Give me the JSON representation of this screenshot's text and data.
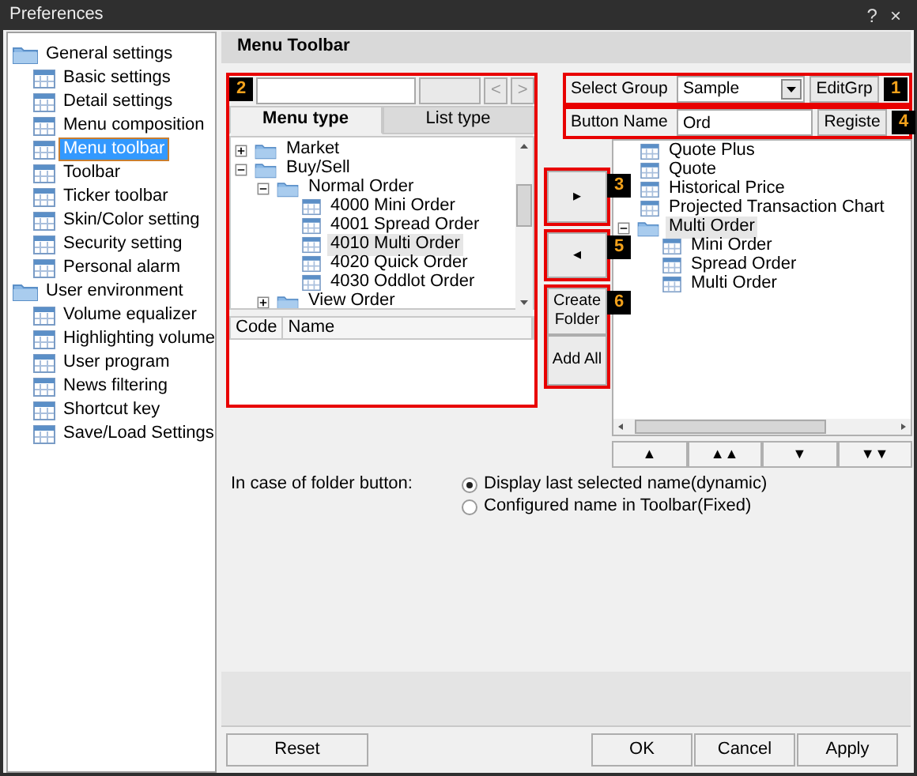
{
  "window": {
    "title": "Preferences",
    "controls": [
      "?",
      "×"
    ]
  },
  "sidebar": {
    "groups": [
      {
        "label": "General settings",
        "items": [
          {
            "label": "Basic settings",
            "selected": false
          },
          {
            "label": "Detail settings",
            "selected": false
          },
          {
            "label": "Menu composition",
            "selected": false
          },
          {
            "label": "Menu toolbar",
            "selected": true
          },
          {
            "label": "Toolbar",
            "selected": false
          },
          {
            "label": "Ticker toolbar",
            "selected": false
          },
          {
            "label": "Skin/Color setting",
            "selected": false
          },
          {
            "label": "Security setting",
            "selected": false
          },
          {
            "label": "Personal alarm",
            "selected": false
          }
        ]
      },
      {
        "label": "User environment",
        "items": [
          {
            "label": "Volume equalizer",
            "selected": false
          },
          {
            "label": "Highlighting volume",
            "selected": false
          },
          {
            "label": "User program",
            "selected": false
          },
          {
            "label": "News filtering",
            "selected": false
          },
          {
            "label": "Shortcut key",
            "selected": false
          },
          {
            "label": "Save/Load Settings",
            "selected": false
          }
        ]
      }
    ]
  },
  "page_title": "Menu Toolbar",
  "menu_panel": {
    "badge": "2",
    "nav_buttons": [
      "<",
      ">"
    ],
    "tabs": [
      {
        "label": "Menu type",
        "selected": true
      },
      {
        "label": "List type",
        "selected": false
      }
    ],
    "tree": [
      {
        "kind": "folder",
        "label": "Market",
        "expanded": false,
        "selected": false
      },
      {
        "kind": "folder",
        "label": "Buy/Sell",
        "expanded": true,
        "selected": false,
        "children": [
          {
            "kind": "folder",
            "label": "Normal Order",
            "expanded": true,
            "selected": false,
            "children": [
              {
                "kind": "item",
                "label": "4000 Mini Order",
                "selected": false
              },
              {
                "kind": "item",
                "label": "4001 Spread Order",
                "selected": false
              },
              {
                "kind": "item",
                "label": "4010 Multi Order",
                "selected": true
              },
              {
                "kind": "item",
                "label": "4020 Quick Order",
                "selected": false
              },
              {
                "kind": "item",
                "label": "4030 Oddlot Order",
                "selected": false
              }
            ]
          },
          {
            "kind": "folder",
            "label": "View Order",
            "expanded": false,
            "selected": false
          }
        ]
      }
    ],
    "list_columns": [
      "Code",
      "Name"
    ]
  },
  "group_selector": {
    "badge": "1",
    "label": "Select Group",
    "value": "Sample",
    "button": "EditGrp"
  },
  "button_name": {
    "badge": "4",
    "label": "Button Name",
    "value": "Ord",
    "button": "Registe"
  },
  "transfer_buttons": [
    {
      "badge": "3",
      "labels": [
        "▸"
      ]
    },
    {
      "badge": "5",
      "labels": [
        "◂"
      ]
    },
    {
      "badge": "6",
      "labels": [
        "Create Folder",
        "Add All"
      ]
    }
  ],
  "toolbar_tree": [
    {
      "kind": "item",
      "label": "Quote Plus",
      "selected": false
    },
    {
      "kind": "item",
      "label": "Quote",
      "selected": false
    },
    {
      "kind": "item",
      "label": "Historical Price",
      "selected": false
    },
    {
      "kind": "item",
      "label": "Projected Transaction Chart",
      "selected": false
    },
    {
      "kind": "folder",
      "label": "Multi Order",
      "expanded": true,
      "selected": true,
      "children": [
        {
          "kind": "item",
          "label": "Mini Order",
          "selected": false
        },
        {
          "kind": "item",
          "label": "Spread Order",
          "selected": false
        },
        {
          "kind": "item",
          "label": "Multi Order",
          "selected": false
        }
      ]
    }
  ],
  "order_buttons": [
    "▲",
    "▲▲",
    "▼",
    "▼▼"
  ],
  "folder_option": {
    "label": "In case of folder button:",
    "options": [
      {
        "label": "Display last selected name(dynamic)",
        "selected": true
      },
      {
        "label": "Configured name in Toolbar(Fixed)",
        "selected": false
      }
    ]
  },
  "footer": {
    "left": [
      "Reset"
    ],
    "right": [
      "OK",
      "Cancel",
      "Apply"
    ]
  }
}
